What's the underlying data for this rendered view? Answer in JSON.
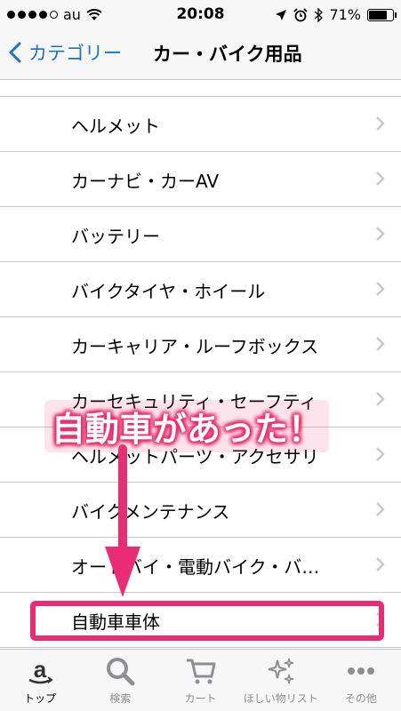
{
  "status_bar": {
    "carrier": "au",
    "time": "20:08",
    "battery": "71%",
    "battery_level": 0.71,
    "signal_bars": 4
  },
  "nav": {
    "back_label": "カテゴリー",
    "title": "カー・バイク用品"
  },
  "list": {
    "items": [
      {
        "label": "ヘルメット"
      },
      {
        "label": "カーナビ・カーAV"
      },
      {
        "label": "バッテリー"
      },
      {
        "label": "バイクタイヤ・ホイール"
      },
      {
        "label": "カーキャリア・ルーフボックス"
      },
      {
        "label": "カーセキュリティ・セーフティ"
      },
      {
        "label": "ヘルメットパーツ・アクセサリ"
      },
      {
        "label": "バイクメンテナンス"
      },
      {
        "label": "オートバイ・電動バイク・バ…"
      },
      {
        "label": "自動車車体"
      }
    ]
  },
  "annotation": {
    "callout": "自動車があった！",
    "accent_color": "#e92c73"
  },
  "tabbar": {
    "tabs": [
      {
        "label": "トップ",
        "icon": "amazon-a-icon"
      },
      {
        "label": "検索",
        "icon": "search-icon"
      },
      {
        "label": "カート",
        "icon": "cart-icon"
      },
      {
        "label": "ほしい物リスト",
        "icon": "sparkle-icon"
      },
      {
        "label": "その他",
        "icon": "more-icon"
      }
    ]
  }
}
